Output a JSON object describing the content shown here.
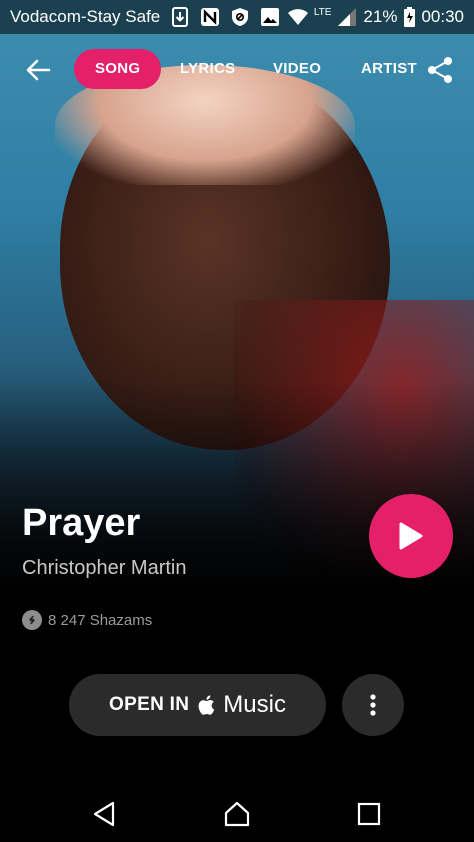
{
  "status_bar": {
    "carrier": "Vodacom-Stay Safe",
    "network": "LTE",
    "battery": "21%",
    "time": "00:30"
  },
  "tabs": [
    {
      "label": "SONG",
      "active": true
    },
    {
      "label": "LYRICS",
      "active": false
    },
    {
      "label": "VIDEO",
      "active": false
    },
    {
      "label": "ARTIST",
      "active": false
    }
  ],
  "song": {
    "title": "Prayer",
    "artist": "Christopher Martin",
    "shazams": "8 247 Shazams"
  },
  "actions": {
    "open_in_label": "OPEN IN",
    "music_label": "Music"
  },
  "colors": {
    "accent": "#e5206a",
    "button_bg": "#2b2b2b",
    "background": "#000000"
  },
  "icons": {
    "back": "arrow-left-icon",
    "share": "share-icon",
    "play": "play-icon",
    "shazam": "shazam-icon",
    "apple": "apple-icon",
    "more": "more-vertical-icon",
    "nav_back": "nav-back-icon",
    "nav_home": "nav-home-icon",
    "nav_recent": "nav-recents-icon"
  }
}
